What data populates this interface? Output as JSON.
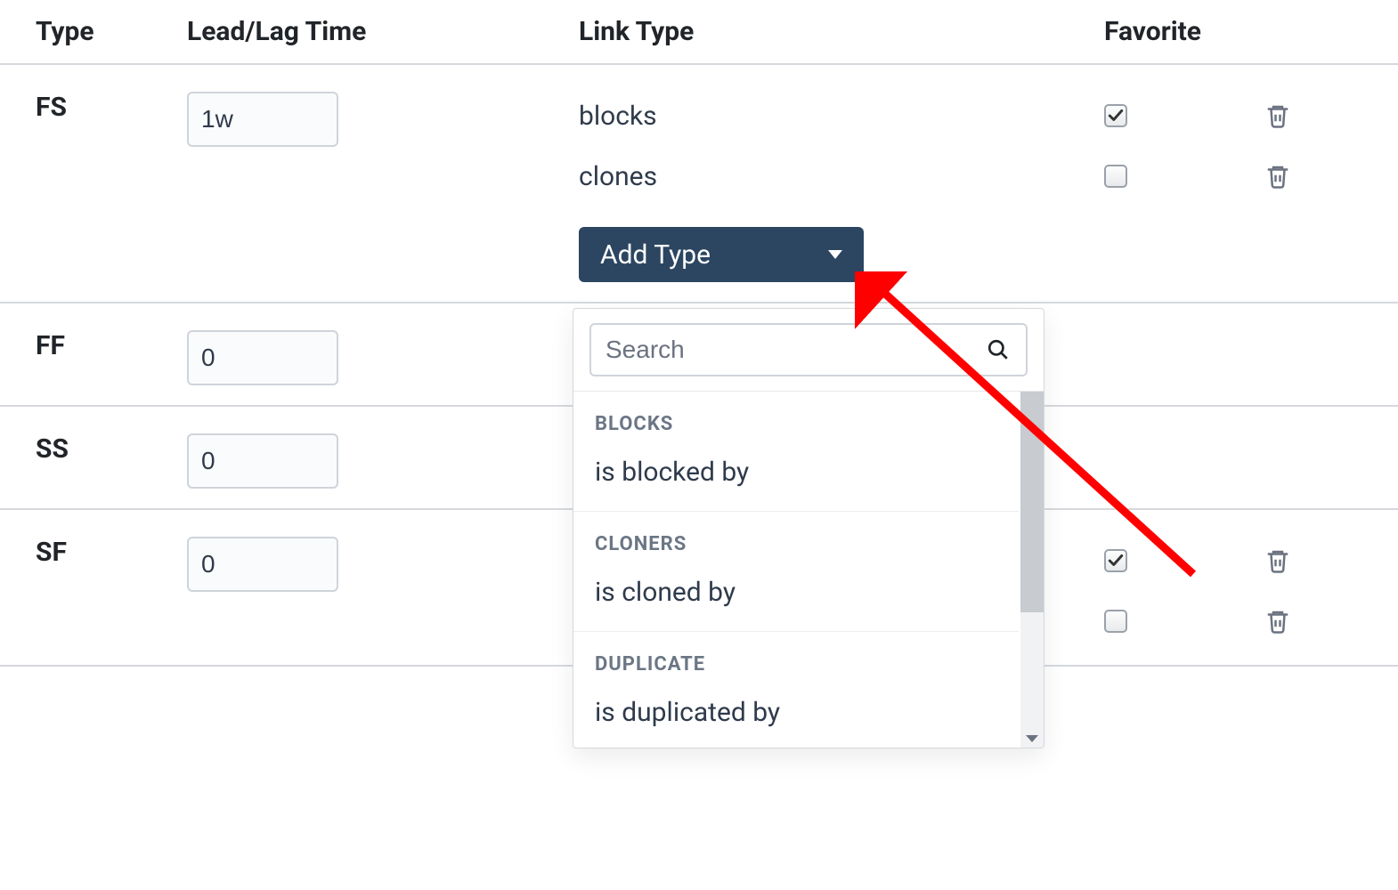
{
  "columns": {
    "type": "Type",
    "lead": "Lead/Lag Time",
    "link": "Link Type",
    "fav": "Favorite"
  },
  "rows": [
    {
      "type": "FS",
      "lead": "1w",
      "links": [
        {
          "label": "blocks",
          "favorite": true
        },
        {
          "label": "clones",
          "favorite": false
        }
      ],
      "addType": true
    },
    {
      "type": "FF",
      "lead": "0",
      "links": []
    },
    {
      "type": "SS",
      "lead": "0",
      "links": []
    },
    {
      "type": "SF",
      "lead": "0",
      "links": [
        {
          "label": "",
          "favorite": true
        },
        {
          "label": "",
          "favorite": false
        }
      ]
    }
  ],
  "addTypeButton": {
    "label": "Add Type"
  },
  "dropdown": {
    "searchPlaceholder": "Search",
    "groups": [
      {
        "header": "BLOCKS",
        "items": [
          "is blocked by"
        ]
      },
      {
        "header": "CLONERS",
        "items": [
          "is cloned by"
        ]
      },
      {
        "header": "DUPLICATE",
        "items": [
          "is duplicated by"
        ]
      }
    ]
  }
}
